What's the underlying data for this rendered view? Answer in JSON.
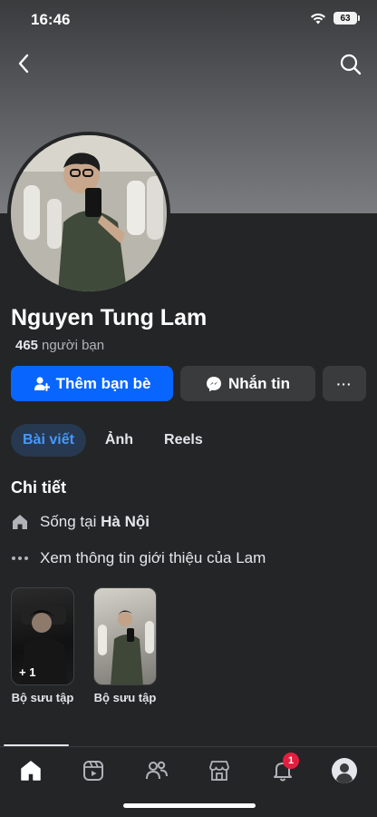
{
  "status_bar": {
    "time": "16:46",
    "battery": "63"
  },
  "profile": {
    "name": "Nguyen Tung Lam",
    "friends_count": "465",
    "friends_label": "người bạn"
  },
  "actions": {
    "add_friend": "Thêm bạn bè",
    "message": "Nhắn tin",
    "more": "···"
  },
  "tabs": [
    {
      "label": "Bài viết",
      "active": true
    },
    {
      "label": "Ảnh",
      "active": false
    },
    {
      "label": "Reels",
      "active": false
    }
  ],
  "details": {
    "title": "Chi tiết",
    "lives_in_prefix": "Sống tại",
    "lives_in_place": "Hà Nội",
    "about_link": "Xem thông tin giới thiệu của Lam"
  },
  "collections": [
    {
      "label": "Bộ sưu tập",
      "count": "+ 1"
    },
    {
      "label": "Bộ sưu tập",
      "count": ""
    }
  ],
  "bottom_nav": {
    "items": [
      "home-icon",
      "video-icon",
      "friends-icon",
      "marketplace-icon",
      "bell-icon",
      "profile-icon"
    ],
    "notification_badge": "1"
  },
  "colors": {
    "accent": "#0866ff",
    "background": "#242526",
    "tab_active_bg": "#263951",
    "tab_active_text": "#4599ff",
    "badge": "#e41e3f"
  }
}
